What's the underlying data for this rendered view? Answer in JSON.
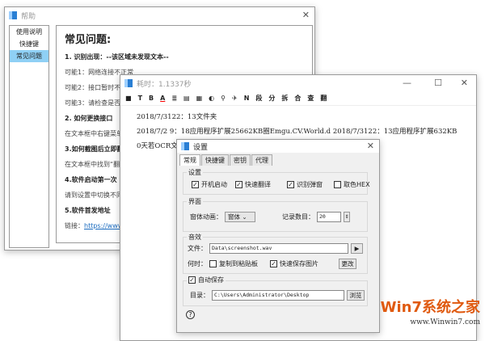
{
  "help": {
    "title": "帮助",
    "close": "✕",
    "sidebar": [
      "使用说明",
      "快捷键",
      "常见问题"
    ],
    "heading": "常见问题:",
    "lines": [
      {
        "t": "1. 识别出现：--该区域未发现文本--",
        "b": true
      },
      {
        "t": "可能1：网络连接不正常",
        "b": false
      },
      {
        "t": "可能2：接口暂时不",
        "b": false
      },
      {
        "t": "可能3：请检查是否",
        "b": false
      },
      {
        "t": "2. 如何更换接口",
        "b": true
      },
      {
        "t": "在文本框中右键菜单",
        "b": false
      },
      {
        "t": "3.如何截图后立即翻",
        "b": true
      },
      {
        "t": "在文本框中找到“翻",
        "b": false
      },
      {
        "t": "4.软件启动第一次",
        "b": true
      },
      {
        "t": "请到设置中切换不同",
        "b": false
      },
      {
        "t": "5.软件首发地址",
        "b": true
      }
    ],
    "link_label": "链接：",
    "link": "https://www"
  },
  "ocr": {
    "title": "耗时：1.1337秒",
    "min": "—",
    "max": "☐",
    "close": "✕",
    "toolbar": [
      "■",
      "T",
      "B",
      "A",
      "≣",
      "▤",
      "▦",
      "◐",
      "⚲",
      "✈",
      "N",
      "段",
      "分",
      "拆",
      "合",
      "查",
      "翻"
    ],
    "lines": [
      "2018/7/3122：13文件夹",
      "2018/7/2 9：18应用程序扩展25662KB圈Emgu.CV.World.d 2018/7/3122：13应用程序扩展632KB",
      "0天若OCR文字识别.exe2018/7/30 17：01应用程序5，047KB"
    ]
  },
  "settings": {
    "title": "设置",
    "close": "✕",
    "tabs": [
      "常规",
      "快捷键",
      "密钥",
      "代理"
    ],
    "g1": {
      "label": "设置",
      "checks": [
        {
          "t": "开机启动",
          "c": true
        },
        {
          "t": "快速翻译",
          "c": true
        },
        {
          "t": "识别弹窗",
          "c": true
        },
        {
          "t": "取色HEX",
          "c": false
        }
      ]
    },
    "g2": {
      "label": "界面",
      "anim_label": "窗体动画：",
      "anim_value": "窗体",
      "count_label": "记录数目：",
      "count_value": "20"
    },
    "g3": {
      "label": "音效",
      "file_label": "文件：",
      "file_value": "Data\\screenshot.wav",
      "play": "▶",
      "when_label": "何时：",
      "copy": "复制到粘贴板",
      "copy_c": false,
      "save": "快速保存图片",
      "save_c": true,
      "change": "更改"
    },
    "g4": {
      "label": "自动保存",
      "checked": true,
      "dir_label": "目录：",
      "dir_value": "C:\\Users\\Administrator\\Desktop",
      "browse": "浏览"
    },
    "help_icon": "?"
  },
  "watermark": {
    "brand": "Win7系统之家",
    "url": "www.Winwin7.com"
  }
}
